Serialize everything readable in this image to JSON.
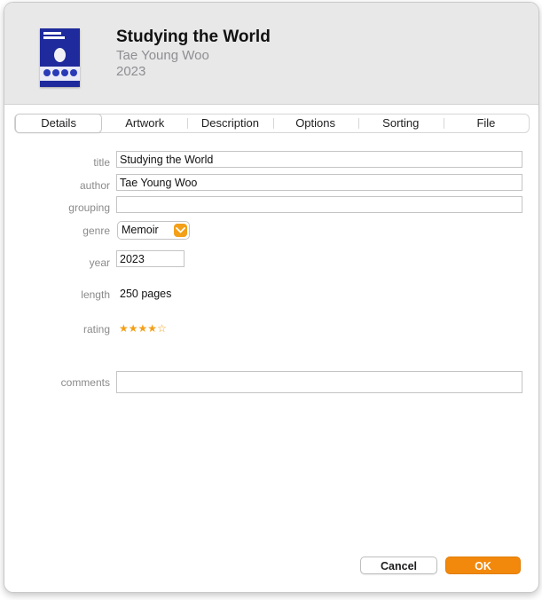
{
  "header": {
    "title": "Studying the World",
    "author": "Tae Young Woo",
    "year": "2023"
  },
  "tabs": [
    {
      "label": "Details",
      "active": true
    },
    {
      "label": "Artwork"
    },
    {
      "label": "Description"
    },
    {
      "label": "Options"
    },
    {
      "label": "Sorting"
    },
    {
      "label": "File"
    }
  ],
  "form": {
    "title_label": "title",
    "title_value": "Studying the World",
    "author_label": "author",
    "author_value": "Tae Young Woo",
    "grouping_label": "grouping",
    "grouping_value": "",
    "genre_label": "genre",
    "genre_value": "Memoir",
    "year_label": "year",
    "year_value": "2023",
    "length_label": "length",
    "length_value": "250 pages",
    "rating_label": "rating",
    "rating_value": 4,
    "rating_max": 5,
    "comments_label": "comments",
    "comments_value": ""
  },
  "buttons": {
    "cancel": "Cancel",
    "ok": "OK"
  },
  "colors": {
    "accent": "#f2890c",
    "star": "#f3a018",
    "label": "#8a8a8a"
  },
  "icons": {
    "cover": "book-cover-thumbnail",
    "genre_popup": "chevron-down-icon",
    "rating": "star-icon"
  }
}
